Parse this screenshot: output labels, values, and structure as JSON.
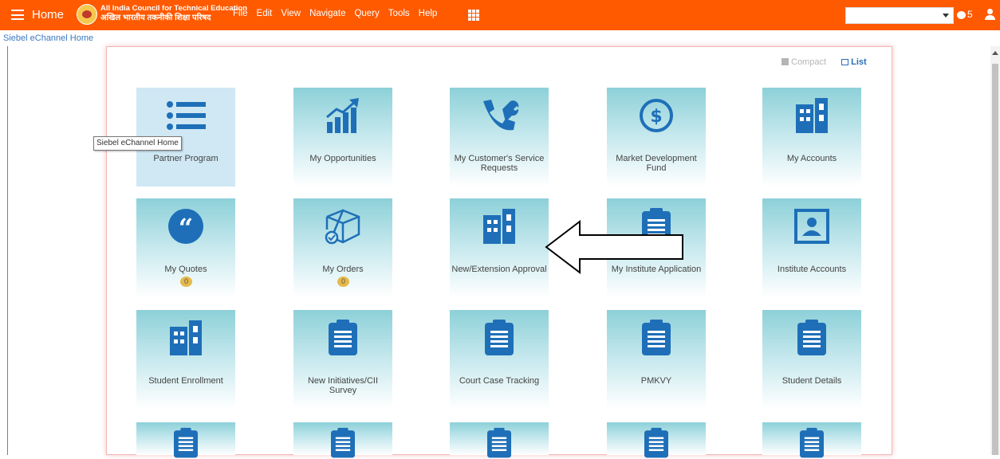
{
  "header": {
    "home_label": "Home",
    "org_line1": "All India Council for Technical Education",
    "org_line2": "अखिल भारतीय तकनीकी शिक्षा परिषद",
    "menu": [
      "File",
      "Edit",
      "View",
      "Navigate",
      "Query",
      "Tools",
      "Help"
    ],
    "notification_count": "5",
    "search_value": ""
  },
  "breadcrumb": "Siebel eChannel Home",
  "view_toggle": {
    "compact": "Compact",
    "list": "List"
  },
  "tooltip": "Siebel eChannel Home",
  "tiles": [
    {
      "label": "Partner Program",
      "icon": "list-icon"
    },
    {
      "label": "My Opportunities",
      "icon": "growth-chart-icon"
    },
    {
      "label": "My Customer's Service Requests",
      "icon": "tools-icon"
    },
    {
      "label": "Market Development Fund",
      "icon": "dollar-icon"
    },
    {
      "label": "My Accounts",
      "icon": "building-icon"
    },
    {
      "label": "My Quotes",
      "icon": "quote-icon",
      "badge": "0"
    },
    {
      "label": "My Orders",
      "icon": "box-icon",
      "badge": "0"
    },
    {
      "label": "New/Extension Approval",
      "icon": "building-icon"
    },
    {
      "label": "My Institute Application",
      "icon": "clipboard-icon"
    },
    {
      "label": "Institute Accounts",
      "icon": "contact-icon"
    },
    {
      "label": "Student Enrollment",
      "icon": "building-icon"
    },
    {
      "label": "New Initiatives/CII Survey",
      "icon": "clipboard-icon"
    },
    {
      "label": "Court Case Tracking",
      "icon": "clipboard-icon"
    },
    {
      "label": "PMKVY",
      "icon": "clipboard-icon"
    },
    {
      "label": "Student Details",
      "icon": "clipboard-icon"
    },
    {
      "label": "",
      "icon": "clipboard-icon"
    },
    {
      "label": "",
      "icon": "clipboard-icon"
    },
    {
      "label": "",
      "icon": "clipboard-icon"
    },
    {
      "label": "",
      "icon": "clipboard-icon"
    },
    {
      "label": "",
      "icon": "clipboard-icon"
    }
  ],
  "colors": {
    "header": "#ff5a00",
    "icon": "#1e6fb8",
    "link": "#3a79c2"
  }
}
